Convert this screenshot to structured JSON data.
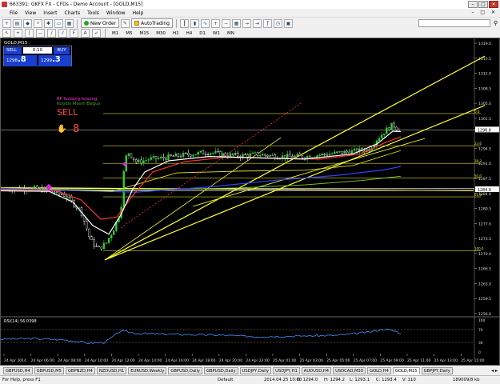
{
  "window": {
    "title": "663391: GKFX FX - CFDs - Demo Account - [GOLD,M15]"
  },
  "menu": {
    "items": [
      "File",
      "View",
      "Insert",
      "Charts",
      "Tools",
      "Window",
      "Help"
    ]
  },
  "toolbar": {
    "new_order_label": "New Order",
    "autotrading_label": "AutoTrading",
    "timeframes": [
      "M1",
      "M5",
      "M15",
      "M30",
      "H1",
      "H4",
      "D1",
      "W1",
      "MN"
    ]
  },
  "chart": {
    "symbol_label": "GOLD,M15",
    "trade_panel": {
      "sell_label": "SELL",
      "buy_label": "BUY",
      "lot_value": "0.10",
      "bid_prefix": "1298",
      "bid_big": ".8",
      "ask_prefix": "1299",
      "ask_big": ".3"
    },
    "signal": {
      "line1": "BP kubang kosong",
      "line2": "Koodis Masih Bagus",
      "sell_text": "SELL",
      "count": "8"
    },
    "price_axis_labels": [
      "1319.0",
      "1315.5",
      "1312.0",
      "1308.5",
      "1305.0",
      "1301.5",
      "1298.8",
      "1294.5",
      "1291.0",
      "1287.5",
      "1284.0",
      "1280.5",
      "1277.0",
      "1273.5",
      "1270.0",
      "1266.5",
      "1263.0",
      "1259.5",
      "1256.0"
    ],
    "current_price_label": "1298.8",
    "highlight_price_label": "1284.9",
    "fib_labels": [
      "0.0",
      "23.6",
      "38.2",
      "50.0",
      "61.8",
      "100.0"
    ],
    "time_axis_labels": [
      "24 Apr 2014",
      "24 Apr 06:00",
      "24 Apr 08:00",
      "24 Apr 10:00",
      "24 Apr 12:00",
      "24 Apr 14:00",
      "24 Apr 16:00",
      "24 Apr 18:00",
      "24 Apr 20:00",
      "24 Apr 22:00",
      "25 Apr 01:00",
      "25 Apr 03:00",
      "25 Apr 05:00",
      "25 Apr 07:00",
      "25 Apr 09:00",
      "25 Apr 11:00",
      "25 Apr 13:00",
      "25 Apr 15:00"
    ],
    "rsi_label": "RSI(14) 56.0398",
    "rsi_axis_labels": [
      "100",
      "70",
      "30",
      "0"
    ],
    "colors": {
      "background": "#000000",
      "bull_candle": "#33cc33",
      "bear_candle": "#ffffff",
      "trendline": "#ffff33",
      "ma_white": "#ffffff",
      "ma_red": "#ff3030",
      "ma_blue": "#3040ff",
      "ma_green": "#7fcf30",
      "rsi_line": "#4a8fff"
    }
  },
  "tabs": {
    "items": [
      "GBPUSD,H4",
      "GBPUSD,M5",
      "GBPNZD,H4",
      "NZDUSD,H1",
      "EURUSD,Weekly",
      "GBPUSD,Daily",
      "GBPUSD,Daily",
      "USDJPY,Daily",
      "USDJPY,H1",
      "AUDUSD,H4",
      "USDCAD,M30",
      "GOLD,H4",
      "GOLD,M15",
      "GBPJPY,Daily"
    ],
    "active_index": 12
  },
  "status": {
    "help": "For Help, press F1",
    "profile": "Default",
    "datetime": "2014.04.25 10:00",
    "open": "O: 1294.0",
    "high": "H: 1294.2",
    "low": "L: 1293.1",
    "close": "C: 1293.4",
    "volume": "V: 110",
    "traffic": "189009/8 kb"
  }
}
